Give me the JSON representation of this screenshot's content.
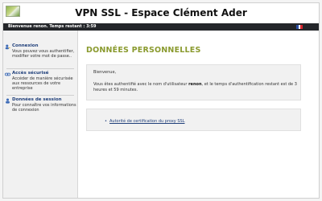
{
  "header": {
    "title": "VPN SSL - Espace Clément Ader",
    "logo_icon": "logo-image"
  },
  "statusbar": {
    "text": "Bienvenue renon. Temps restant : 3:59",
    "language_flag": "french-flag-icon",
    "flag_colors": [
      "#2a4fa3",
      "#ffffff",
      "#d8262e"
    ]
  },
  "sidebar": {
    "items": [
      {
        "title": "Connexion",
        "description": "Vous pouvez vous authentifier, modifier votre mot de passe..",
        "icon": "user-key-icon"
      },
      {
        "title": "Accès sécurisé",
        "description": "Accéder de manière sécurisée aux ressources de votre entreprise",
        "icon": "link-icon"
      },
      {
        "title": "Données de session",
        "description": "Pour connaître vos informations de connexion",
        "icon": "user-icon"
      }
    ]
  },
  "main": {
    "page_title": "DONNÉES PERSONNELLES",
    "welcome": {
      "title": "Bienvenue,",
      "text_before": "Vous êtes authentifié avec le nom d'utilisateur ",
      "username": "renon",
      "text_after": ", et le temps d'authentification restant est de 3 heures et 59 minutes."
    },
    "links": [
      {
        "label": "Autorité de certification du proxy SSL"
      }
    ]
  },
  "colors": {
    "accent_title": "#8a9a2e",
    "nav_link": "#1f3f7a",
    "statusbar_bg": "#24262a"
  }
}
